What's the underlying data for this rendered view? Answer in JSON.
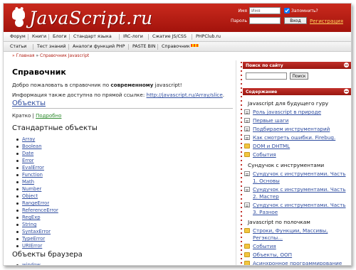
{
  "header": {
    "logo_text": "JavaScript.ru",
    "login": {
      "name_label": "Имя",
      "name_placeholder": "Имя",
      "password_label": "Пароль",
      "remember_label": "Запомнить?",
      "enter_label": "Вход",
      "register_label": "Регистрация"
    }
  },
  "nav": {
    "row1": [
      "Форум",
      "Книги",
      "Блоги",
      "Стандарт языка",
      "IRC-логи",
      "Сжатие JS/CSS",
      "PHPClub.ru"
    ],
    "row2": [
      "Статьи",
      "Тест знаний",
      "Аналоги функций PHP",
      "PASTE BIN",
      "Справочник"
    ]
  },
  "breadcrumb": {
    "home": "Главная",
    "separator": "»",
    "current": "Справочник Javascript"
  },
  "main": {
    "title": "Справочник",
    "intro_prefix": "Добро пожаловать в справочник по ",
    "intro_bold": "современному",
    "intro_suffix": " javascript!",
    "info_prefix": "Информация также доступна по прямой ссылке: ",
    "info_link": "http://javascript.ru/Array/slice",
    "info_suffix": ".",
    "objects_heading": "Объекты",
    "short_label": "Кратко",
    "pipe": "|",
    "detailed_label": "Подробно",
    "standard_heading": "Стандартные объекты",
    "standard_objects": [
      "Array",
      "Boolean",
      "Date",
      "Error",
      "EvalError",
      "Function",
      "Math",
      "Number",
      "Object",
      "RangeError",
      "ReferenceError",
      "RegExp",
      "String",
      "SyntaxError",
      "TypeError",
      "URIError"
    ],
    "browser_heading": "Объекты браузера",
    "browser_objects": [
      "window"
    ]
  },
  "sidebar": {
    "search_title": "Поиск по сайту",
    "search_button": "Поиск",
    "contents_title": "Содержание",
    "sections": [
      {
        "title": "Javascript для будущего гуру"
      },
      {
        "title": "Сундучок с инструментами"
      },
      {
        "title": "Javascript по полочкам"
      }
    ],
    "items_guru": [
      {
        "label": "Роль javascript в природе",
        "icon": "doc"
      },
      {
        "label": "Первые шаги",
        "icon": "doc"
      },
      {
        "label": "Подбираем инструментарий",
        "icon": "doc"
      },
      {
        "label": "Как смотреть ошибки. Firebug.",
        "icon": "doc"
      },
      {
        "label": "DOM и DHTML",
        "icon": "folder"
      },
      {
        "label": "События",
        "icon": "folder"
      }
    ],
    "items_tools": [
      {
        "label": "Сундучок с инструментами. Часть 1. Основы",
        "icon": "doc"
      },
      {
        "label": "Сундучок с инструментами. Часть 2. Мастер",
        "icon": "doc"
      },
      {
        "label": "Сундучок с инструментами. Часть 3. Разное",
        "icon": "doc"
      }
    ],
    "items_shelves": [
      {
        "label": "Строки, Функции, Массивы, Регэкспы...",
        "icon": "folder"
      },
      {
        "label": "События",
        "icon": "folder"
      },
      {
        "label": "Объекты, ООП",
        "icon": "folder"
      },
      {
        "label": "Асинхронное программирование",
        "icon": "folder"
      }
    ]
  }
}
